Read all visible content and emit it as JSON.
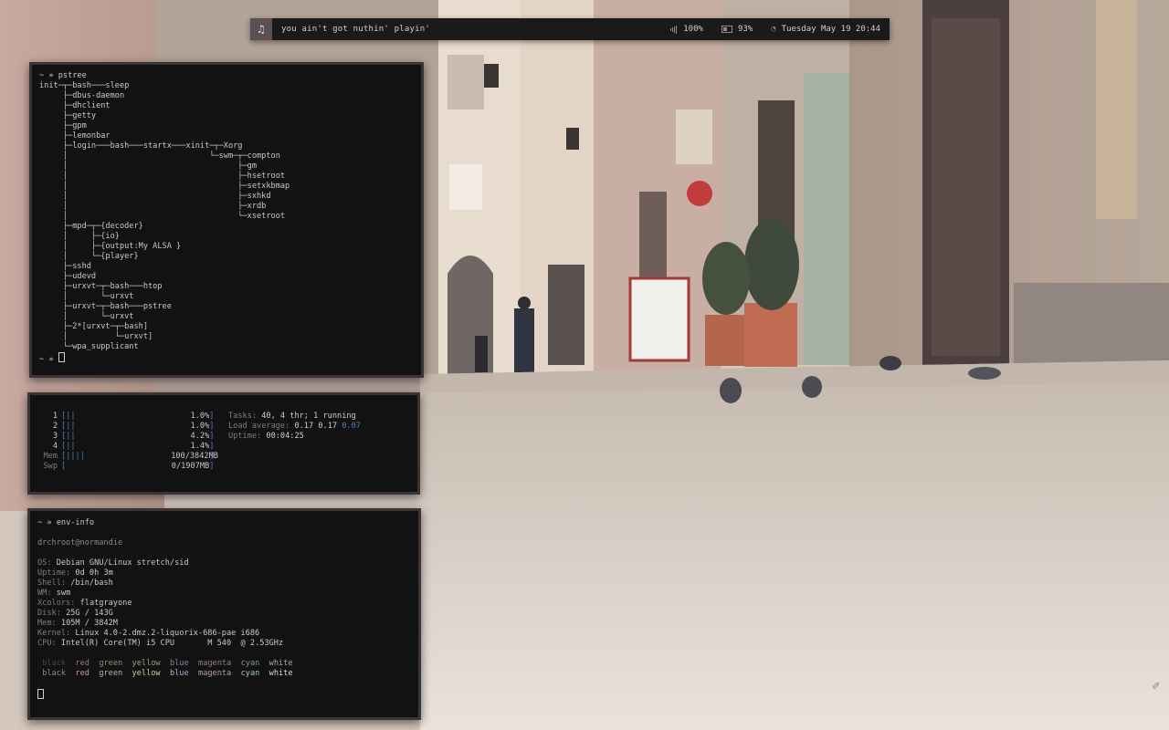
{
  "topbar": {
    "music_icon": "music-note-icon",
    "song": "you ain't got nuthin' playin'",
    "volume": "100%",
    "battery": "93%",
    "datetime": "Tuesday May 19 20:44"
  },
  "pstree": {
    "prompt": "~ »",
    "command": "pstree",
    "lines": [
      "init─┬─bash───sleep",
      "     ├─dbus-daemon",
      "     ├─dhclient",
      "     ├─getty",
      "     ├─gpm",
      "     ├─lemonbar",
      "     ├─login───bash───startx───xinit─┬─Xorg",
      "     │                              └─swm─┬─compton",
      "     │                                    ├─gm",
      "     │                                    ├─hsetroot",
      "     │                                    ├─setxkbmap",
      "     │                                    ├─sxhkd",
      "     │                                    ├─xrdb",
      "     │                                    └─xsetroot",
      "     ├─mpd─┬─{decoder}",
      "     │     ├─{io}",
      "     │     ├─{output:My ALSA }",
      "     │     └─{player}",
      "     ├─sshd",
      "     ├─udevd",
      "     ├─urxvt─┬─bash───htop",
      "     │       └─urxvt",
      "     ├─urxvt─┬─bash───pstree",
      "     │       └─urxvt",
      "     ├─2*[urxvt─┬─bash]",
      "     │          └─urxvt]",
      "     └─wpa_supplicant"
    ],
    "end_prompt": "~ »"
  },
  "htop": {
    "cpus": [
      {
        "label": "1",
        "bar": "||",
        "pct": "1.0%",
        "usage": 1.0
      },
      {
        "label": "2",
        "bar": "||",
        "pct": "1.0%",
        "usage": 1.0
      },
      {
        "label": "3",
        "bar": "||",
        "pct": "4.2%",
        "usage": 4.2
      },
      {
        "label": "4",
        "bar": "||",
        "pct": "1.4%",
        "usage": 1.4
      }
    ],
    "mem": {
      "label": "Mem",
      "bar": "||||",
      "value": "100/3842MB"
    },
    "swp": {
      "label": "Swp",
      "bar": "",
      "value": "0/1907MB"
    },
    "tasks_label": "Tasks:",
    "tasks_value": "40, 4 thr; 1 running",
    "load_label": "Load average:",
    "load_1": "0.17",
    "load_5": "0.17",
    "load_15": "0.07",
    "uptime_label": "Uptime:",
    "uptime_value": "00:04:25"
  },
  "envinfo": {
    "prompt": "~ »",
    "command": "env-info",
    "userhost": "drchroot@normandie",
    "rows": [
      {
        "key": "OS:",
        "value": "Debian GNU/Linux stretch/sid"
      },
      {
        "key": "Uptime:",
        "value": "0d 0h 3m"
      },
      {
        "key": "Shell:",
        "value": "/bin/bash"
      },
      {
        "key": "WM:",
        "value": "swm"
      },
      {
        "key": "Xcolors:",
        "value": "flatgrayone"
      },
      {
        "key": "Disk:",
        "value": "25G / 143G"
      },
      {
        "key": "Mem:",
        "value": "105M / 3842M"
      },
      {
        "key": "Kernel:",
        "value": "Linux 4.0-2.dmz.2-liquorix-686-pae i686"
      },
      {
        "key": "CPU:",
        "value": "Intel(R) Core(TM) i5 CPU       M 540  @ 2.53GHz"
      }
    ],
    "colors": [
      "black",
      "red",
      "green",
      "yellow",
      "blue",
      "magenta",
      "cyan",
      "white"
    ]
  }
}
